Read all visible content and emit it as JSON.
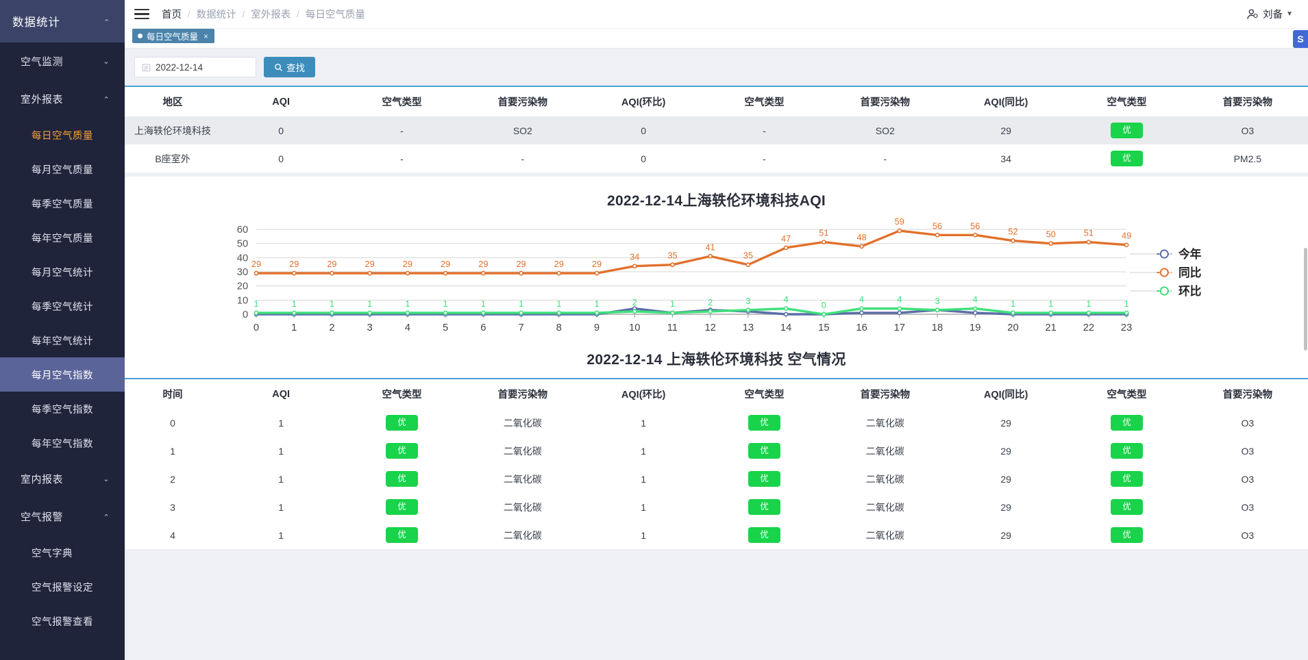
{
  "sidebar": {
    "title": "数据统计",
    "groups": [
      {
        "label": "空气监测",
        "expanded": false
      },
      {
        "label": "室外报表",
        "expanded": true
      },
      {
        "label": "室内报表",
        "expanded": false
      },
      {
        "label": "空气报警",
        "expanded": true
      }
    ],
    "outdoor_items": [
      "每日空气质量",
      "每月空气质量",
      "每季空气质量",
      "每年空气质量",
      "每月空气统计",
      "每季空气统计",
      "每年空气统计",
      "每月空气指数",
      "每季空气指数",
      "每年空气指数"
    ],
    "alarm_items": [
      "空气字典",
      "空气报警设定",
      "空气报警查看"
    ],
    "active_orange": "每日空气质量",
    "active_blue": "每月空气指数"
  },
  "header": {
    "breadcrumb": [
      "首页",
      "数据统计",
      "室外报表",
      "每日空气质量"
    ],
    "separator": "/",
    "user_name": "刘备",
    "user_caret": "▼"
  },
  "tab": {
    "label": "每日空气质量",
    "close": "×"
  },
  "search": {
    "date_value": "2022-12-14",
    "button_label": "查找"
  },
  "summary_table": {
    "columns": [
      "地区",
      "AQI",
      "空气类型",
      "首要污染物",
      "AQI(环比)",
      "空气类型",
      "首要污染物",
      "AQI(同比)",
      "空气类型",
      "首要污染物"
    ],
    "rows": [
      {
        "cells": [
          "上海轶伦环境科技",
          "0",
          "-",
          "SO2",
          "0",
          "-",
          "SO2",
          "29",
          "优",
          "O3"
        ],
        "badge_index": 8
      },
      {
        "cells": [
          "B座室外",
          "0",
          "-",
          "-",
          "0",
          "-",
          "-",
          "34",
          "优",
          "PM2.5"
        ],
        "badge_index": 8
      }
    ]
  },
  "chart_data": {
    "type": "line",
    "title": "2022-12-14上海轶伦环境科技AQI",
    "xlabel": "",
    "ylabel": "",
    "ylim": [
      0,
      60
    ],
    "yticks": [
      0,
      10,
      20,
      30,
      40,
      50,
      60
    ],
    "grid": true,
    "legend_position": "right",
    "categories": [
      "0",
      "1",
      "2",
      "3",
      "4",
      "5",
      "6",
      "7",
      "8",
      "9",
      "10",
      "11",
      "12",
      "13",
      "14",
      "15",
      "16",
      "17",
      "18",
      "19",
      "20",
      "21",
      "22",
      "23"
    ],
    "series": [
      {
        "name": "今年",
        "color": "#5b6ea8",
        "values": [
          0,
          0,
          0,
          0,
          0,
          0,
          0,
          0,
          0,
          0,
          4,
          1,
          3,
          2,
          0,
          0,
          1,
          1,
          3,
          1,
          0,
          0,
          0,
          0
        ],
        "labels_shown": false
      },
      {
        "name": "同比",
        "color": "#e1712c",
        "values": [
          29,
          29,
          29,
          29,
          29,
          29,
          29,
          29,
          29,
          29,
          34,
          35,
          41,
          35,
          47,
          51,
          48,
          59,
          56,
          56,
          52,
          50,
          51,
          49
        ],
        "labels_shown": true
      },
      {
        "name": "环比",
        "color": "#3ee07a",
        "values": [
          1,
          1,
          1,
          1,
          1,
          1,
          1,
          1,
          1,
          1,
          2,
          1,
          2,
          3,
          4,
          0,
          4,
          4,
          3,
          4,
          1,
          1,
          1,
          1
        ],
        "labels_shown": true
      }
    ]
  },
  "detail_section_title": "2022-12-14 上海轶伦环境科技 空气情况",
  "detail_table": {
    "columns": [
      "时间",
      "AQI",
      "空气类型",
      "首要污染物",
      "AQI(环比)",
      "空气类型",
      "首要污染物",
      "AQI(同比)",
      "空气类型",
      "首要污染物"
    ],
    "rows": [
      {
        "cells": [
          "0",
          "1",
          "优",
          "二氧化碳",
          "1",
          "优",
          "二氧化碳",
          "29",
          "优",
          "O3"
        ],
        "badge_indexes": [
          2,
          5,
          8
        ]
      },
      {
        "cells": [
          "1",
          "1",
          "优",
          "二氧化碳",
          "1",
          "优",
          "二氧化碳",
          "29",
          "优",
          "O3"
        ],
        "badge_indexes": [
          2,
          5,
          8
        ]
      },
      {
        "cells": [
          "2",
          "1",
          "优",
          "二氧化碳",
          "1",
          "优",
          "二氧化碳",
          "29",
          "优",
          "O3"
        ],
        "badge_indexes": [
          2,
          5,
          8
        ]
      },
      {
        "cells": [
          "3",
          "1",
          "优",
          "二氧化碳",
          "1",
          "优",
          "二氧化碳",
          "29",
          "优",
          "O3"
        ],
        "badge_indexes": [
          2,
          5,
          8
        ]
      },
      {
        "cells": [
          "4",
          "1",
          "优",
          "二氧化碳",
          "1",
          "优",
          "二氧化碳",
          "29",
          "优",
          "O3"
        ],
        "badge_indexes": [
          2,
          5,
          8
        ]
      }
    ]
  },
  "float_button": {
    "label": "S"
  },
  "colors": {
    "sidebar_bg": "#20243a",
    "sidebar_active_blue": "#5a6499",
    "sidebar_active_orange": "#f0a035",
    "primary": "#3c8dbc",
    "badge_green": "#19d34b",
    "series_today": "#5b6ea8",
    "series_yoy": "#e1712c",
    "series_mom": "#3ee07a"
  }
}
